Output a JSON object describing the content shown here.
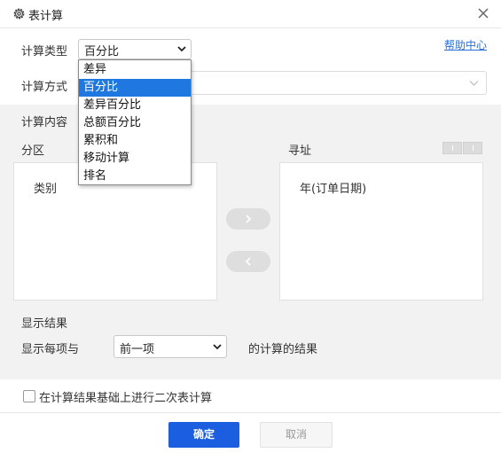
{
  "dialog": {
    "title": "表计算",
    "title_icon": "gear-icon",
    "close_icon": "close-icon"
  },
  "calc_type": {
    "label": "计算类型",
    "selected": "百分比",
    "options": [
      "差异",
      "百分比",
      "差异百分比",
      "总额百分比",
      "累积和",
      "移动计算",
      "排名"
    ],
    "highlighted_index": 1,
    "help_link": "帮助中心"
  },
  "calc_method": {
    "label": "计算方式"
  },
  "calc_content": {
    "section_label": "计算内容",
    "partition": {
      "label": "分区",
      "items": [
        "类别"
      ]
    },
    "addressing": {
      "label": "寻址",
      "items": [
        "年(订单日期)"
      ]
    }
  },
  "display": {
    "section_label": "显示结果",
    "prefix": "显示每项与",
    "selected": "前一项",
    "suffix": "的计算的结果"
  },
  "secondary": {
    "label": "在计算结果基础上进行二次表计算",
    "checked": false
  },
  "footer": {
    "ok_label": "确定",
    "cancel_label": "取消"
  },
  "colors": {
    "accent": "#1b5fe0",
    "link": "#2a6fd6",
    "highlight": "#1e78e0",
    "panel_bg": "#f2f2f2"
  }
}
